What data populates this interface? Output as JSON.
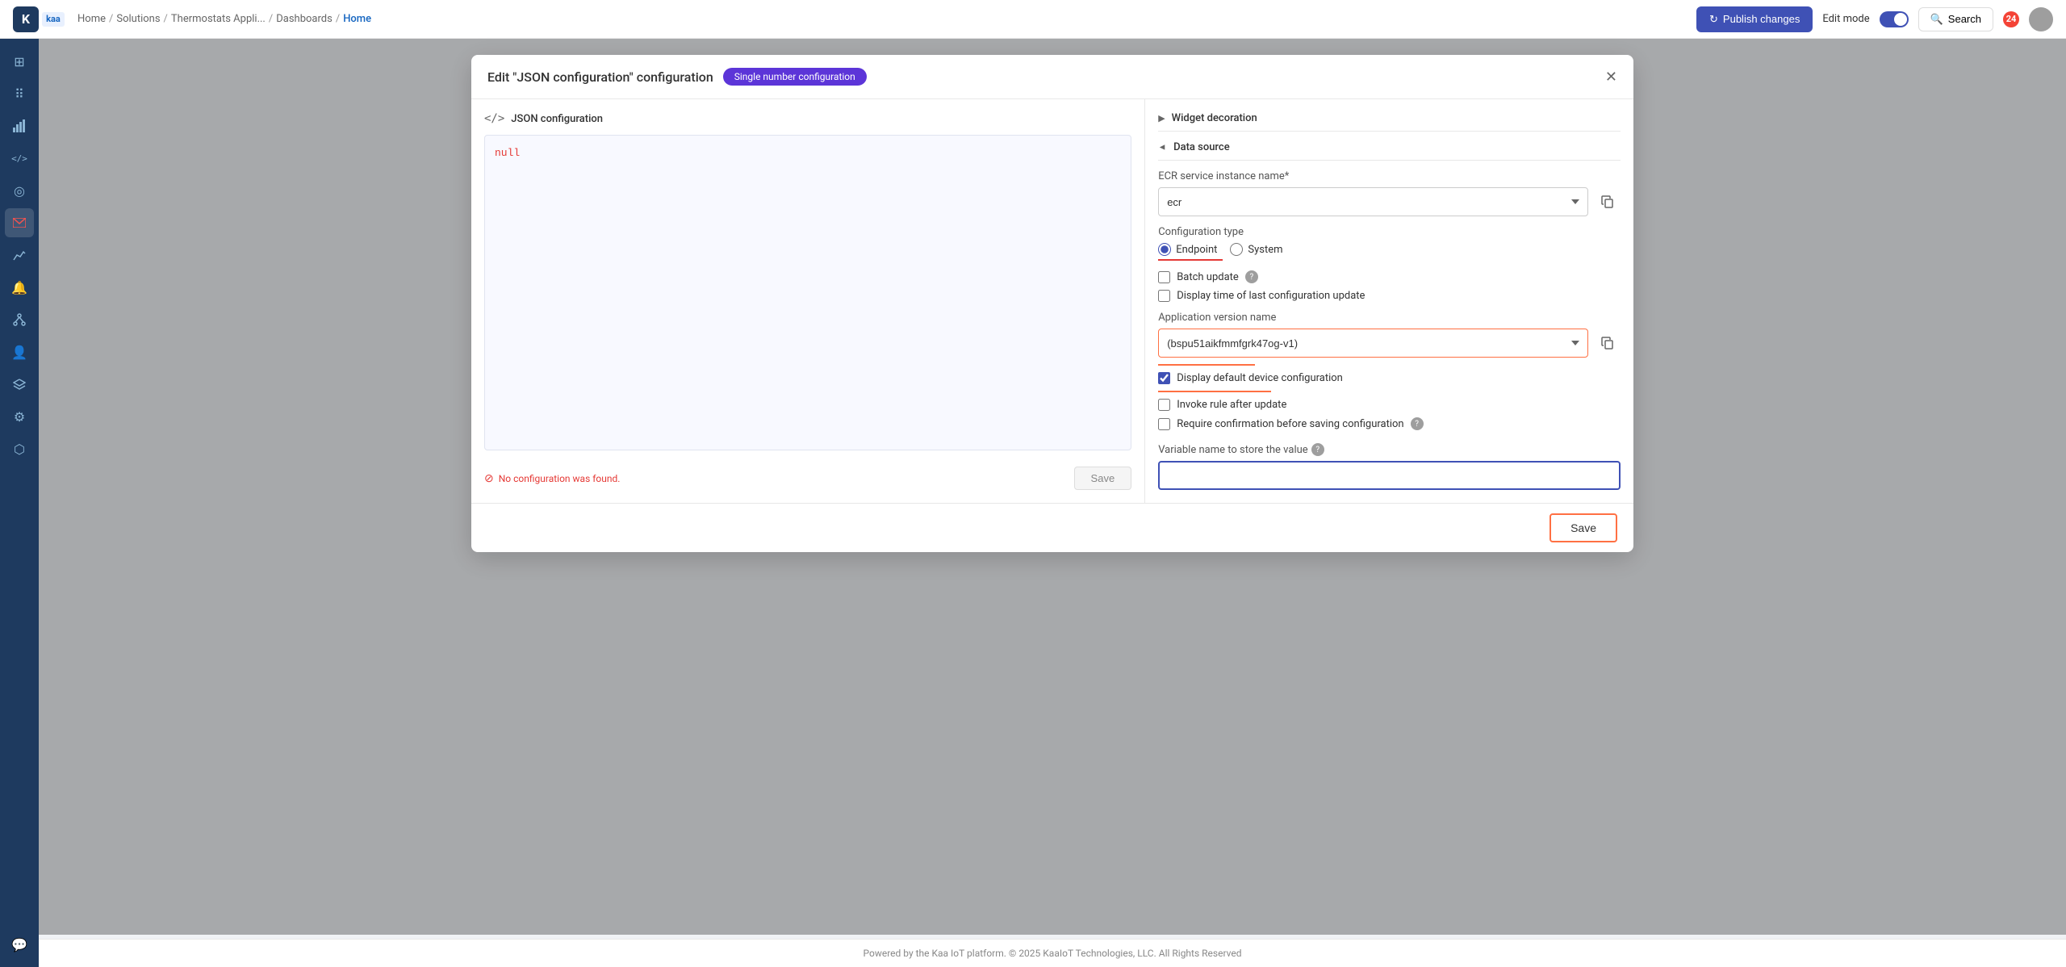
{
  "topNav": {
    "logoText": "K",
    "kaaText": "kaa",
    "breadcrumbs": [
      {
        "label": "Home",
        "href": "#"
      },
      {
        "label": "Solutions",
        "href": "#"
      },
      {
        "label": "Thermostats Appli...",
        "href": "#"
      },
      {
        "label": "Dashboards",
        "href": "#"
      },
      {
        "label": "Home",
        "href": "#",
        "current": true
      }
    ],
    "publishLabel": "Publish changes",
    "editModeLabel": "Edit mode",
    "searchLabel": "Search",
    "notifCount": "24"
  },
  "sidebar": {
    "icons": [
      {
        "name": "grid-icon",
        "symbol": "⊞"
      },
      {
        "name": "apps-icon",
        "symbol": "⠿"
      },
      {
        "name": "signal-icon",
        "symbol": "📶"
      },
      {
        "name": "code-icon",
        "symbol": "</>"
      },
      {
        "name": "target-icon",
        "symbol": "◎"
      },
      {
        "name": "mail-icon",
        "symbol": "✉",
        "active": true
      },
      {
        "name": "chart-icon",
        "symbol": "📈"
      },
      {
        "name": "bell-icon",
        "symbol": "🔔"
      },
      {
        "name": "network-icon",
        "symbol": "⟳"
      },
      {
        "name": "user-icon",
        "symbol": "👤"
      },
      {
        "name": "layers-icon",
        "symbol": "⧉"
      },
      {
        "name": "gear-icon",
        "symbol": "⚙"
      },
      {
        "name": "puzzle-icon",
        "symbol": "⬡"
      },
      {
        "name": "chat-icon",
        "symbol": "💬"
      }
    ]
  },
  "modal": {
    "title": "Edit \"JSON configuration\" configuration",
    "badgeLabel": "Single number configuration",
    "jsonPanelTitle": "JSON configuration",
    "jsonContent": "null",
    "saveLabel": "Save",
    "errorMsg": "No configuration was found.",
    "widgetDecorationLabel": "Widget decoration",
    "dataSourceLabel": "Data source",
    "ecrServiceLabel": "ECR service instance name*",
    "ecrServiceValue": "ecr",
    "configTypeLabel": "Configuration type",
    "endpointLabel": "Endpoint",
    "systemLabel": "System",
    "batchUpdateLabel": "Batch update",
    "displayTimeLabel": "Display time of last configuration update",
    "appVersionLabel": "Application version name",
    "appVersionValue": "(bspu51aikfmmfgrk47og-v1)",
    "displayDefaultLabel": "Display default device configuration",
    "invokeRuleLabel": "Invoke rule after update",
    "requireConfirmLabel": "Require confirmation before saving configuration",
    "variableLabel": "Variable name to store the value",
    "variablePlaceholder": "",
    "saveBtnLabel": "Save"
  },
  "footer": {
    "text": "Powered by the Kaa IoT platform. © 2025 KaaIoT Technologies, LLC. All Rights Reserved"
  }
}
